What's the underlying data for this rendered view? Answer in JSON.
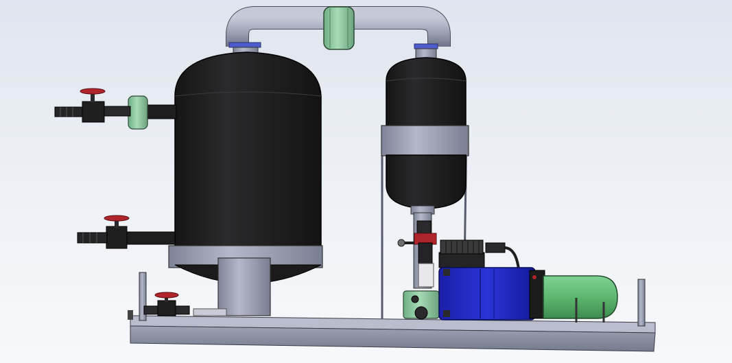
{
  "scene": {
    "kind": "3D CAD render",
    "background_color": "#e6eaf1",
    "components": [
      "base-frame",
      "large-vessel",
      "small-vessel",
      "overhead-pipe",
      "pipe-couplings",
      "hose-barb-valves",
      "air-compressor",
      "motor",
      "green-tank"
    ]
  },
  "colors": {
    "vessel_black": "#1e1e1f",
    "steel": "#9b9fb2",
    "steel_dark": "#6d7184",
    "coupling_green": "#8cc7a0",
    "motor_blue": "#1d25c8",
    "tank_green": "#6ac27d",
    "valve_red": "#b0242c",
    "band_blue": "#4d5ccc"
  }
}
